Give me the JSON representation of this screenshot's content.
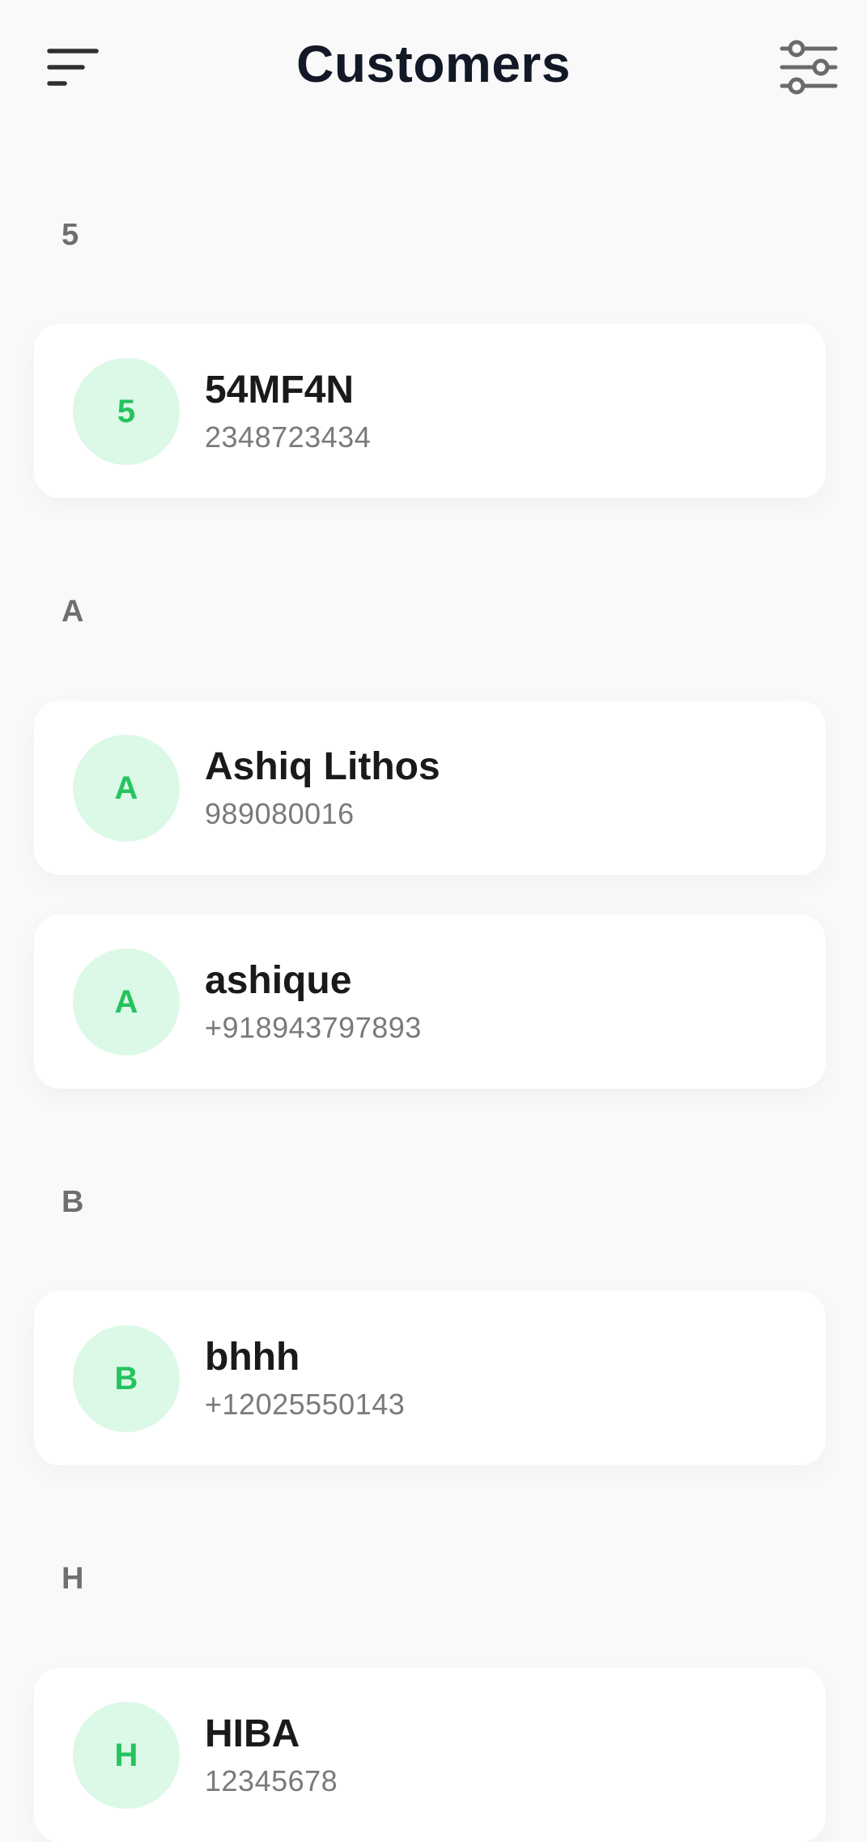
{
  "header": {
    "title": "Customers",
    "menu_icon": "menu-icon",
    "filter_icon": "sliders-icon"
  },
  "colors": {
    "background": "#f9f9f9",
    "card": "#ffffff",
    "avatar_bg": "#dcf8e6",
    "avatar_text": "#25c35e",
    "title": "#121826",
    "section_header": "#6f6f6f",
    "phone": "#7a7a7a"
  },
  "sections": [
    {
      "letter": "5",
      "customers": [
        {
          "initial": "5",
          "name": "54MF4N",
          "phone": "2348723434"
        }
      ]
    },
    {
      "letter": "A",
      "customers": [
        {
          "initial": "A",
          "name": "Ashiq Lithos",
          "phone": "989080016"
        },
        {
          "initial": "A",
          "name": "ashique",
          "phone": "+918943797893"
        }
      ]
    },
    {
      "letter": "B",
      "customers": [
        {
          "initial": "B",
          "name": "bhhh",
          "phone": "+12025550143"
        }
      ]
    },
    {
      "letter": "H",
      "customers": [
        {
          "initial": "H",
          "name": "HIBA",
          "phone": "12345678"
        }
      ]
    }
  ]
}
